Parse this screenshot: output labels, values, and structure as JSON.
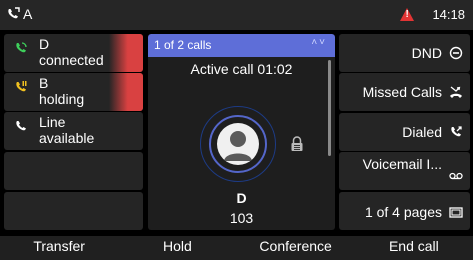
{
  "status_bar": {
    "account": "A",
    "time": "14:18",
    "warning_color": "#e23434"
  },
  "lines": [
    {
      "name": "D",
      "status": "connected",
      "icon": "phone-connected-icon",
      "icon_color": "#3ecf5b",
      "alert": true
    },
    {
      "name": "B",
      "status": "holding",
      "icon": "phone-hold-icon",
      "icon_color": "#f0c020",
      "alert": true
    },
    {
      "name": "Line",
      "status": "available",
      "icon": "phone-icon",
      "icon_color": "#ffffff",
      "alert": false
    },
    {
      "name": "",
      "status": ""
    },
    {
      "name": "",
      "status": ""
    }
  ],
  "call": {
    "counter": "1 of 2 calls",
    "status": "Active call 01:02",
    "name": "D",
    "number": "103",
    "header_color": "#5e6ed8"
  },
  "right_keys": [
    {
      "label": "DND",
      "icon": "dnd-icon"
    },
    {
      "label": "Missed Calls",
      "icon": "missed-calls-icon"
    },
    {
      "label": "Dialed",
      "icon": "dialed-calls-icon"
    },
    {
      "label": "Voicemail I...",
      "icon": "voicemail-icon"
    },
    {
      "label": "1 of 4 pages",
      "icon": "pages-icon"
    }
  ],
  "softkeys": [
    "Transfer",
    "Hold",
    "Conference",
    "End call"
  ]
}
